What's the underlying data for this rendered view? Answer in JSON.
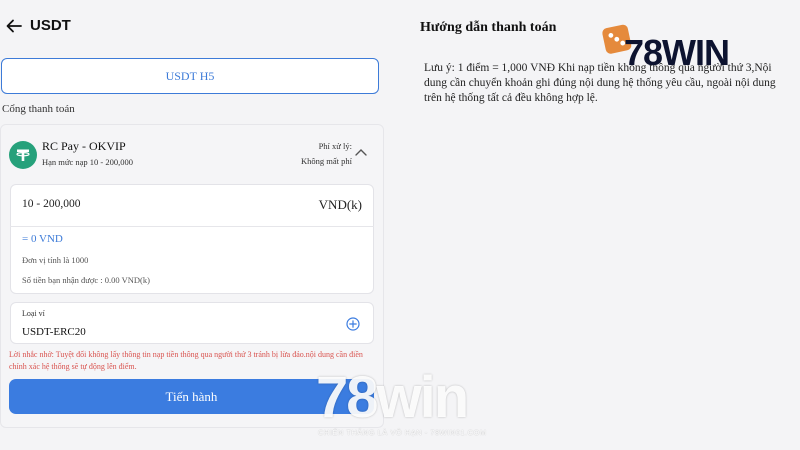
{
  "header": {
    "title": "USDT"
  },
  "tabs": [
    {
      "label": "USDT H5"
    }
  ],
  "payment": {
    "section_label": "Cổng thanh toán",
    "gateway": {
      "name": "RC Pay - OKVIP",
      "limit": "Hạn mức nạp 10 - 200,000",
      "fee_label": "Phí xử lý:",
      "fee_value": "Không mất phí"
    },
    "amount": {
      "range": "10 - 200,000",
      "unit": "VND(k)",
      "converted": "= 0 VND",
      "unit_note": "Đơn vị tính là 1000",
      "receive_note": "Số tiền bạn nhận được : 0.00 VND(k)"
    },
    "wallet": {
      "label": "Loại ví",
      "value": "USDT-ERC20"
    },
    "warning": "Lời nhắc nhở: Tuyệt đối không lấy thông tin nạp tiền thông qua người thứ 3 tránh bị lừa đảo.nội dung cần điền chính xác hệ thống sẽ tự động lên điểm.",
    "submit_label": "Tiến hành"
  },
  "guide": {
    "title": "Hướng dẫn thanh toán",
    "text": "Lưu ý: 1 điểm = 1,000 VNĐ Khi nạp tiền không thông qua người thứ 3,Nội dung cần chuyển khoản ghi đúng nội dung hệ thống yêu cầu, ngoài nội dung trên hệ thống tất cả đều không hợp lệ."
  },
  "branding": {
    "logo_text": "78WIN",
    "watermark_text": "78win",
    "watermark_sub": "CHIẾN THẮNG LÀ VÔ HẠN - 78WIN01.COM"
  },
  "colors": {
    "accent": "#3b7ce0",
    "tether": "#26a17b",
    "warning": "#d9534f",
    "logo_dark": "#0d1330",
    "logo_orange": "#e58a3c"
  },
  "icons": {
    "back": "arrow-left-icon",
    "gateway": "tether-icon",
    "collapse": "chevron-up-icon",
    "add_wallet": "plus-circle-icon"
  }
}
